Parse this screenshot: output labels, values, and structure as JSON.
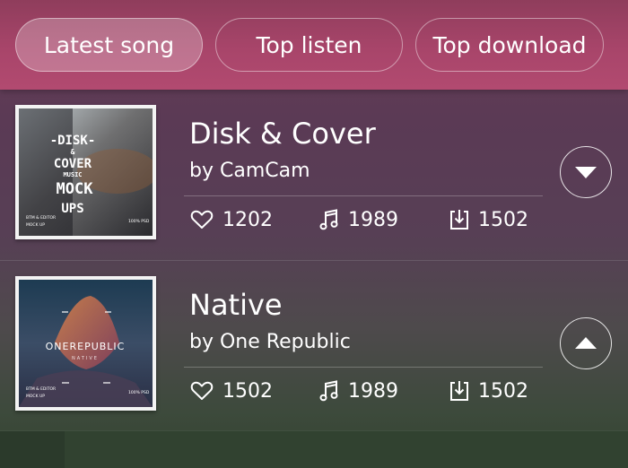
{
  "tabs": [
    {
      "label": "Latest song",
      "active": true
    },
    {
      "label": "Top listen",
      "active": false
    },
    {
      "label": "Top download",
      "active": false
    }
  ],
  "songs": [
    {
      "title": "Disk & Cover",
      "artist": "by CamCam",
      "likes": "1202",
      "plays": "1989",
      "downloads": "1502",
      "toggle_icon": "chevron-down-icon",
      "cover": {
        "lines": [
          "-DISK-",
          "&",
          "COVER",
          "MUSIC",
          "MOCK",
          "UPS"
        ],
        "corner_left": "BTM & EDITOR",
        "corner_left_2": "MOCK UP",
        "corner_right": "100% PSD"
      }
    },
    {
      "title": "Native",
      "artist": "by One Republic",
      "likes": "1502",
      "plays": "1989",
      "downloads": "1502",
      "toggle_icon": "chevron-up-icon",
      "cover": {
        "lines": [
          "ONEREPUBLIC",
          "NATIVE"
        ],
        "corner_left": "BTM & EDITOR",
        "corner_left_2": "MOCK UP",
        "corner_right": "100% PSD"
      }
    }
  ],
  "colors": {
    "tab_bar": "#a8456a",
    "text": "#ffffff"
  }
}
